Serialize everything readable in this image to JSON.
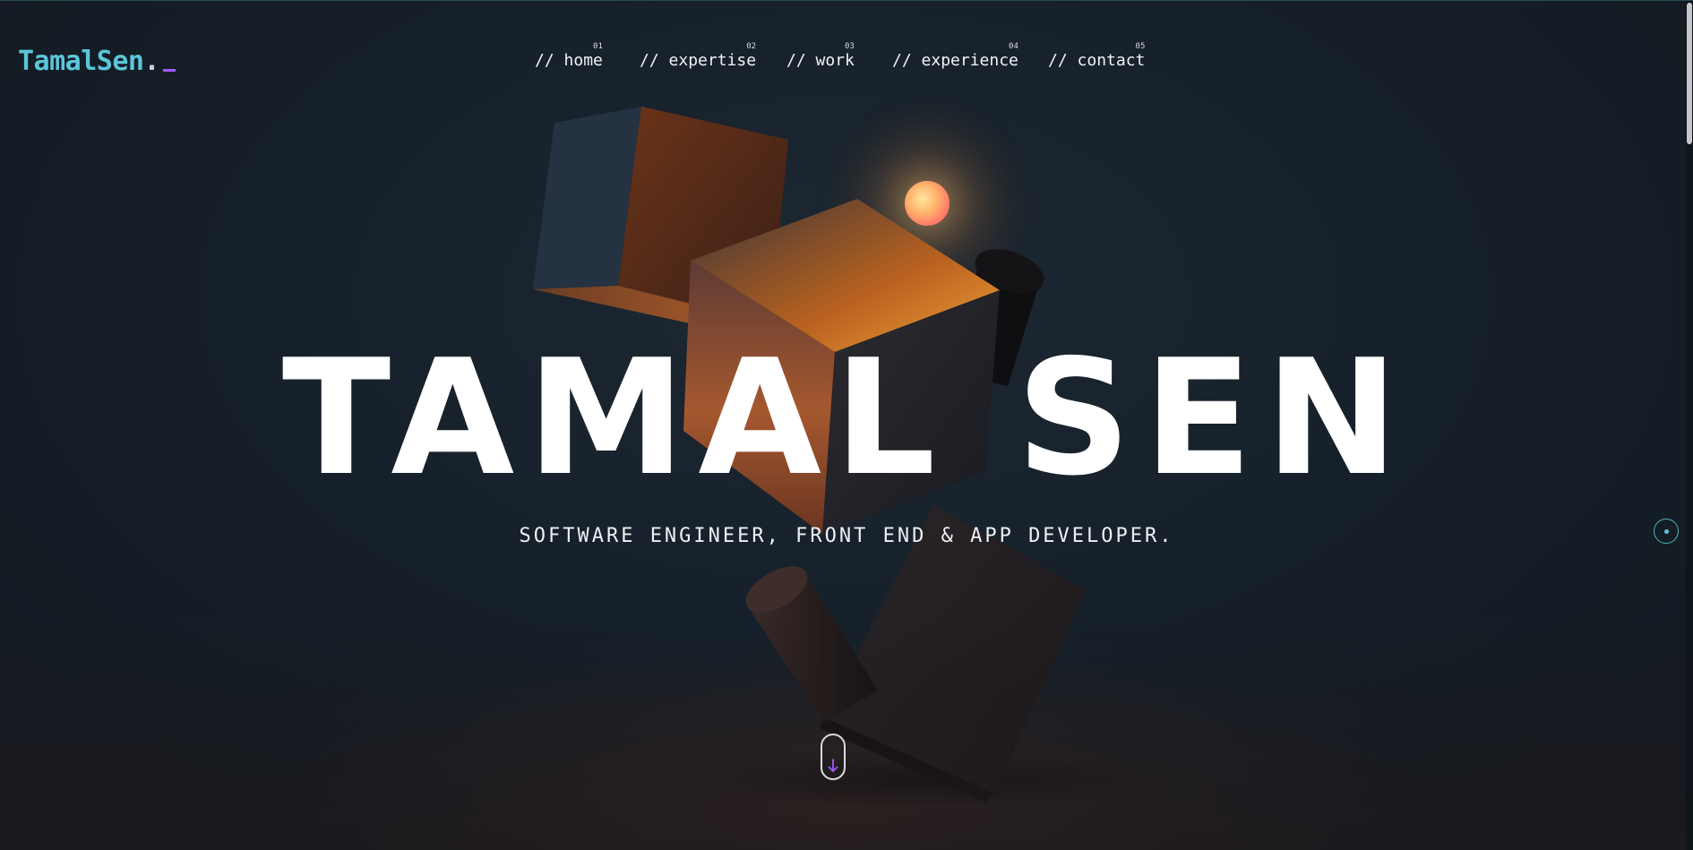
{
  "logo": {
    "text": "TamalSen",
    "dot": "."
  },
  "nav": {
    "items": [
      {
        "prefix": "// ",
        "label": "home",
        "num": "01"
      },
      {
        "prefix": "// ",
        "label": "expertise",
        "num": "02"
      },
      {
        "prefix": "// ",
        "label": "work",
        "num": "03"
      },
      {
        "prefix": "// ",
        "label": "experience",
        "num": "04"
      },
      {
        "prefix": "// ",
        "label": "contact",
        "num": "05"
      }
    ]
  },
  "hero": {
    "name": "TAMAL SEN",
    "subtitle": "SOFTWARE ENGINEER, FRONT END & APP DEVELOPER."
  },
  "colors": {
    "accent_cyan": "#5cc6d9",
    "accent_purple": "#a259ff",
    "background": "#151d25"
  },
  "icons": {
    "scroll": "arrow-down-icon",
    "side": "section-dot-icon"
  }
}
